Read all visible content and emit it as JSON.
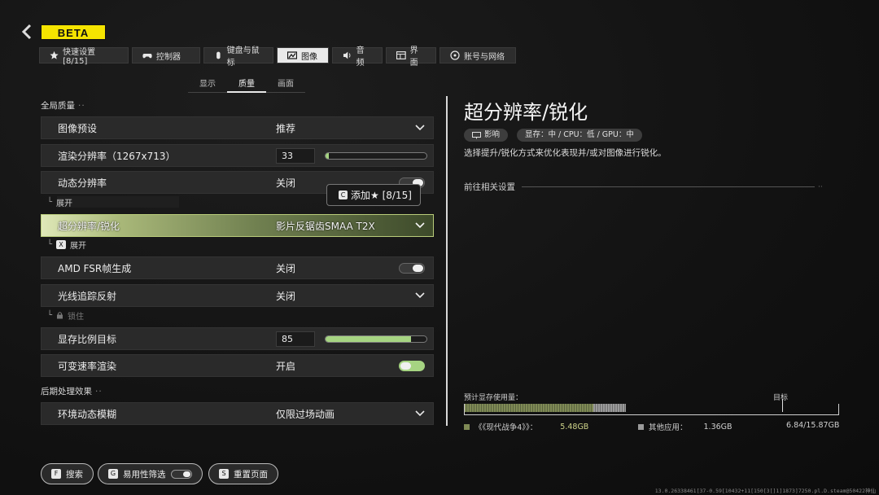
{
  "header": {
    "badge": "BETA"
  },
  "tabs": [
    {
      "label": "快速设置 [8/15]",
      "icon": "star-icon",
      "active": false
    },
    {
      "label": "控制器",
      "icon": "gamepad-icon",
      "active": false
    },
    {
      "label": "键盘与鼠标",
      "icon": "mouse-icon",
      "active": false
    },
    {
      "label": "图像",
      "icon": "image-icon",
      "active": true
    },
    {
      "label": "音频",
      "icon": "speaker-icon",
      "active": false
    },
    {
      "label": "界面",
      "icon": "interface-icon",
      "active": false
    },
    {
      "label": "账号与网络",
      "icon": "network-icon",
      "active": false
    }
  ],
  "subtabs": [
    {
      "label": "显示",
      "active": false
    },
    {
      "label": "质量",
      "active": true
    },
    {
      "label": "画面",
      "active": false
    }
  ],
  "sections": {
    "global_quality": "全局质量",
    "post_processing": "后期处理效果"
  },
  "settings": {
    "preset": {
      "label": "图像预设",
      "value": "推荐"
    },
    "render_res": {
      "label": "渲染分辨率（1267x713）",
      "value": "33",
      "level": 0.03
    },
    "dynamic_res": {
      "label": "动态分辨率",
      "value": "关闭",
      "on": false
    },
    "dynamic_res_expand": "展开",
    "upscaling": {
      "label": "超分辨率/锐化",
      "value": "影片反锯齿SMAA T2X"
    },
    "upscaling_expand": "展开",
    "fsr_framegen": {
      "label": "AMD FSR帧生成",
      "value": "关闭",
      "on": false
    },
    "rt_reflections": {
      "label": "光线追踪反射",
      "value": "关闭"
    },
    "rt_locked": "锁住",
    "vram_target": {
      "label": "显存比例目标",
      "value": "85",
      "level": 0.85
    },
    "vrs": {
      "label": "可变速率渲染",
      "value": "开启",
      "on": true
    },
    "motion_blur": {
      "label": "环境动态模糊",
      "value": "仅限过场动画"
    }
  },
  "tooltip": {
    "text": "添加★ [8/15]",
    "key": "C"
  },
  "right_panel": {
    "title": "超分辨率/锐化",
    "impact_tag": "影响",
    "perf_tag": "显存：中 / CPU：低 / GPU：中",
    "description": "选择提升/锐化方式来优化表现并/或对图像进行锐化。",
    "goto_related": "前往相关设置"
  },
  "vram": {
    "usage_label": "预计显存使用量：",
    "target_label": "目标",
    "game_label": "《《现代战争4》》：",
    "game_value": "5.48GB",
    "game_gb": 5.48,
    "other_label": "其他应用：",
    "other_value": "1.36GB",
    "other_gb": 1.36,
    "total_value": "6.84/15.87GB",
    "total_gb": 15.87,
    "target_fraction": 0.85,
    "colors": {
      "game": "#7f8a55",
      "other": "#9a9a9a"
    }
  },
  "bottom_bar": {
    "search": {
      "label": "搜索",
      "key": "F"
    },
    "accessibility": {
      "label": "易用性筛选",
      "key": "G"
    },
    "reset": {
      "label": "重置页面",
      "key": "S"
    }
  },
  "build_info": "13.0.26338461[37-0.59[10432+11[150[3[]1]1873]7250.pl.D.steam@50422神仙",
  "colors": {
    "accent": "#a6d482",
    "badge": "#f5e400",
    "highlight": "#b9cc7a"
  }
}
